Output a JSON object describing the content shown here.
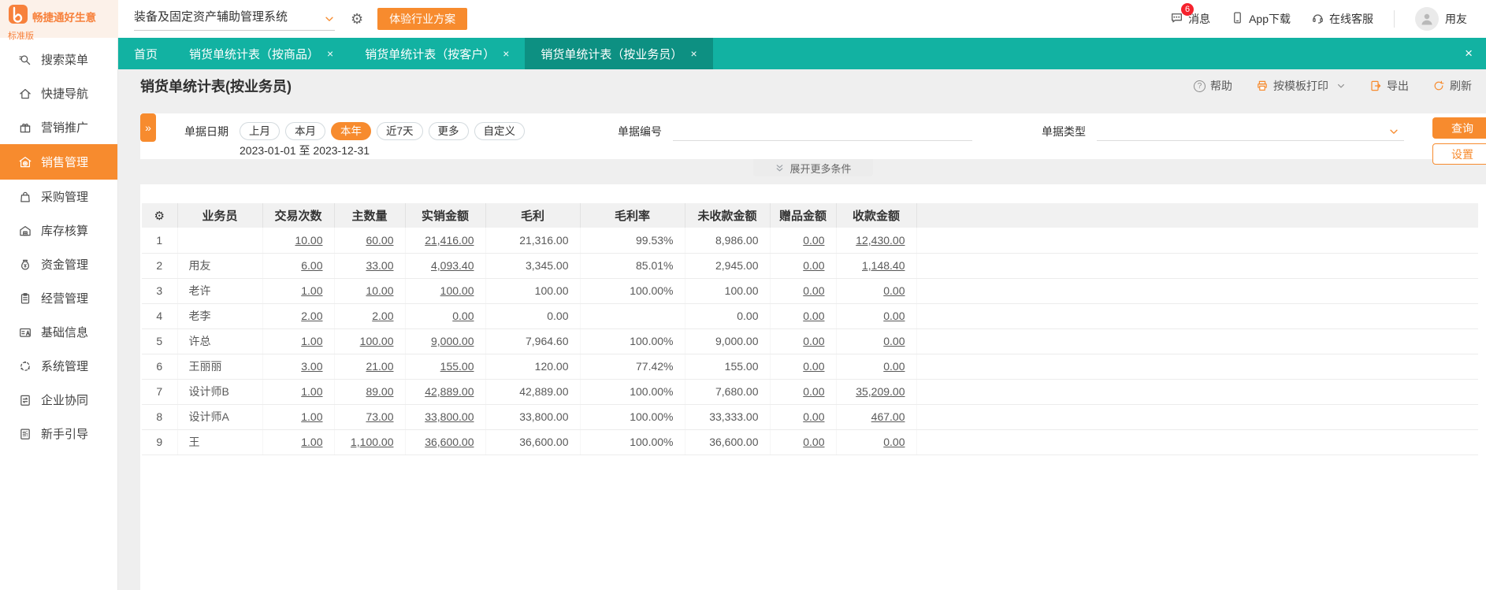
{
  "colors": {
    "teal": "#12b2a2",
    "teal_active": "#0d9082",
    "orange": "#f78b2e",
    "badge_red": "#f5222d",
    "page_bg": "#efefef"
  },
  "topbar": {
    "logo_title": "畅捷通好生意",
    "logo_edition": "标准版",
    "system_select": "装备及固定资产辅助管理系统",
    "trial_button": "体验行业方案",
    "messages_label": "消息",
    "messages_badge": "6",
    "app_download_label": "App下载",
    "online_service_label": "在线客服",
    "user_name": "用友"
  },
  "sidebar": {
    "items": [
      {
        "label": "搜索菜单",
        "icon": "search-icon",
        "active": false
      },
      {
        "label": "快捷导航",
        "icon": "home-icon",
        "active": false
      },
      {
        "label": "营销推广",
        "icon": "gift-icon",
        "active": false
      },
      {
        "label": "销售管理",
        "icon": "sales-shop-icon",
        "active": true
      },
      {
        "label": "采购管理",
        "icon": "purchase-bag-icon",
        "active": false
      },
      {
        "label": "库存核算",
        "icon": "warehouse-icon",
        "active": false
      },
      {
        "label": "资金管理",
        "icon": "money-bag-icon",
        "active": false
      },
      {
        "label": "经营管理",
        "icon": "clipboard-icon",
        "active": false
      },
      {
        "label": "基础信息",
        "icon": "id-card-icon",
        "active": false
      },
      {
        "label": "系统管理",
        "icon": "system-circle-icon",
        "active": false
      },
      {
        "label": "企业协同",
        "icon": "collab-icon",
        "active": false
      },
      {
        "label": "新手引导",
        "icon": "guide-icon",
        "active": false
      }
    ]
  },
  "tabs": [
    {
      "label": "首页",
      "closable": false,
      "active": false
    },
    {
      "label": "销货单统计表（按商品）",
      "closable": true,
      "active": false
    },
    {
      "label": "销货单统计表（按客户）",
      "closable": true,
      "active": false
    },
    {
      "label": "销货单统计表（按业务员）",
      "closable": true,
      "active": true
    }
  ],
  "page": {
    "title": "销货单统计表(按业务员)",
    "toolbar": [
      {
        "label": "帮助",
        "icon": "help-icon"
      },
      {
        "label": "按模板打印",
        "icon": "printer-icon",
        "has_dropdown": true
      },
      {
        "label": "导出",
        "icon": "export-icon"
      },
      {
        "label": "刷新",
        "icon": "refresh-icon"
      }
    ]
  },
  "filters": {
    "collapse_button": "»",
    "date_label": "单据日期",
    "date_options": [
      "上月",
      "本月",
      "本年",
      "近7天",
      "更多",
      "自定义"
    ],
    "date_selected": "本年",
    "date_start": "2023-01-01",
    "date_separator": "至",
    "date_end": "2023-12-31",
    "doc_no_label": "单据编号",
    "doc_type_label": "单据类型",
    "search_button": "查询",
    "settings_button": "设置",
    "expand_more_label": "展开更多条件"
  },
  "table": {
    "columns": [
      "业务员",
      "交易次数",
      "主数量",
      "实销金额",
      "毛利",
      "毛利率",
      "未收款金额",
      "赠品金额",
      "收款金额"
    ],
    "rows": [
      [
        "1",
        "",
        "10.00",
        "60.00",
        "21,416.00",
        "21,316.00",
        "99.53%",
        "8,986.00",
        "0.00",
        "12,430.00"
      ],
      [
        "2",
        "用友",
        "6.00",
        "33.00",
        "4,093.40",
        "3,345.00",
        "85.01%",
        "2,945.00",
        "0.00",
        "1,148.40"
      ],
      [
        "3",
        "老许",
        "1.00",
        "10.00",
        "100.00",
        "100.00",
        "100.00%",
        "100.00",
        "0.00",
        "0.00"
      ],
      [
        "4",
        "老李",
        "2.00",
        "2.00",
        "0.00",
        "0.00",
        "",
        "0.00",
        "0.00",
        "0.00"
      ],
      [
        "5",
        "许总",
        "1.00",
        "100.00",
        "9,000.00",
        "7,964.60",
        "100.00%",
        "9,000.00",
        "0.00",
        "0.00"
      ],
      [
        "6",
        "王丽丽",
        "3.00",
        "21.00",
        "155.00",
        "120.00",
        "77.42%",
        "155.00",
        "0.00",
        "0.00"
      ],
      [
        "7",
        "设计师B",
        "1.00",
        "89.00",
        "42,889.00",
        "42,889.00",
        "100.00%",
        "7,680.00",
        "0.00",
        "35,209.00"
      ],
      [
        "8",
        "设计师A",
        "1.00",
        "73.00",
        "33,800.00",
        "33,800.00",
        "100.00%",
        "33,333.00",
        "0.00",
        "467.00"
      ],
      [
        "9",
        "王",
        "1.00",
        "1,100.00",
        "36,600.00",
        "36,600.00",
        "100.00%",
        "36,600.00",
        "0.00",
        "0.00"
      ]
    ]
  }
}
